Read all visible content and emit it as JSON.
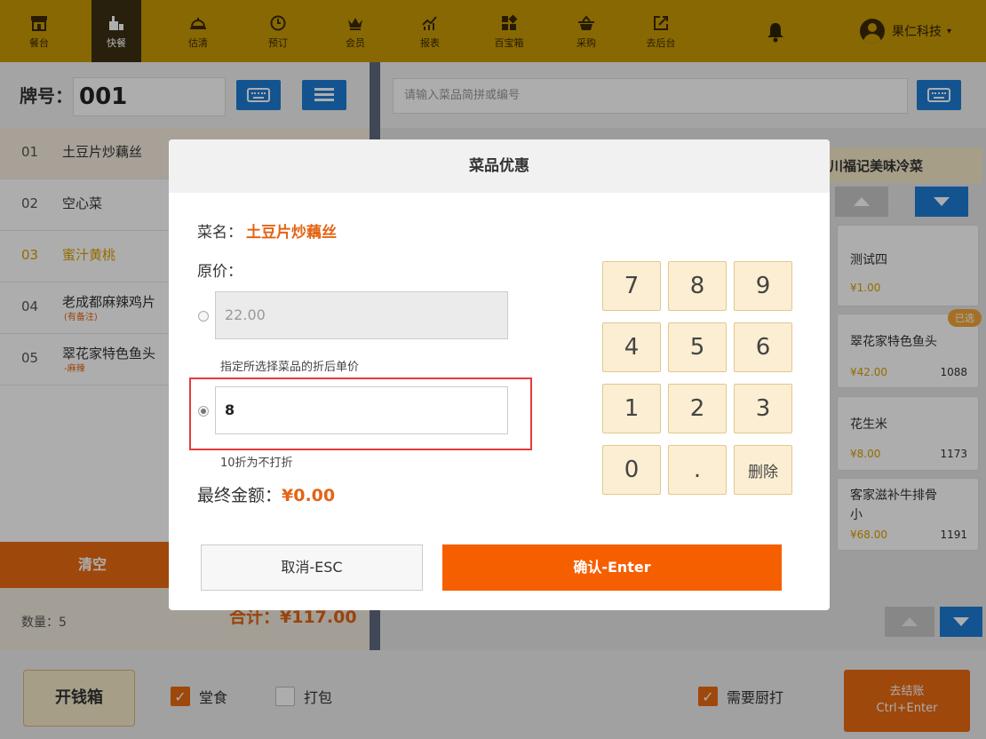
{
  "nav": {
    "items": [
      {
        "label": "餐台",
        "icon": "table-service-icon"
      },
      {
        "label": "快餐",
        "icon": "fast-food-icon"
      },
      {
        "label": "估清",
        "icon": "bell-cover-icon"
      },
      {
        "label": "预订",
        "icon": "clock-icon"
      },
      {
        "label": "会员",
        "icon": "crown-icon"
      },
      {
        "label": "报表",
        "icon": "chart-icon"
      },
      {
        "label": "百宝箱",
        "icon": "toolbox-icon"
      },
      {
        "label": "采购",
        "icon": "basket-icon"
      },
      {
        "label": "去后台",
        "icon": "external-link-icon"
      }
    ],
    "active": "快餐",
    "user_name": "果仁科技",
    "caret": "▾"
  },
  "order": {
    "ticket_label": "牌号：",
    "ticket_no": "001",
    "items": [
      {
        "no": "01",
        "name": "土豆片炒藕丝",
        "note": ""
      },
      {
        "no": "02",
        "name": "空心菜",
        "note": ""
      },
      {
        "no": "03",
        "name": "蜜汁黄桃",
        "note": ""
      },
      {
        "no": "04",
        "name": "老成都麻辣鸡片",
        "note": "(有备注)"
      },
      {
        "no": "05",
        "name": "翠花家特色鱼头",
        "note": "-麻辣"
      }
    ],
    "clear_label": "清空",
    "qty_label": "数量：5",
    "total_label": "合计：¥117.00"
  },
  "menu": {
    "search_placeholder": "请输入菜品简拼或编号",
    "category": "川福记美味冷菜",
    "products": [
      {
        "name": "测试四",
        "price": "¥1.00",
        "code": "",
        "badge": ""
      },
      {
        "name": "翠花家特色鱼头",
        "price": "¥42.00",
        "code": "1088",
        "badge": "已选"
      },
      {
        "name": "花生米",
        "price": "¥8.00",
        "code": "1173",
        "badge": ""
      },
      {
        "name": "客家滋补牛排骨",
        "name2": "小",
        "price": "¥68.00",
        "code": "1191",
        "badge": ""
      }
    ]
  },
  "bottom": {
    "cash_drawer": "开钱箱",
    "dine_in": "堂食",
    "takeaway": "打包",
    "kitchen_print": "需要厨打",
    "checkout_line1": "去结账",
    "checkout_line2": "Ctrl+Enter",
    "check": "✓"
  },
  "dialog": {
    "title": "菜品优惠",
    "dish_label": "菜名：",
    "dish_name": "土豆片炒藕丝",
    "orig_label": "原价：",
    "orig_value": "22.00",
    "hint_price": "指定所选择菜品的折后单价",
    "discount_value": "8",
    "hint_discount": "10折为不打折",
    "final_label": "最终金额：",
    "final_value": "¥0.00",
    "keys": [
      "7",
      "8",
      "9",
      "4",
      "5",
      "6",
      "1",
      "2",
      "3",
      "0",
      ".",
      "删除"
    ],
    "cancel": "取消-ESC",
    "confirm": "确认-Enter"
  },
  "colors": {
    "nav_bg": "#c99a05",
    "accent_orange": "#e96a12",
    "confirm_orange": "#f65f00",
    "blue": "#1c7cd5"
  }
}
